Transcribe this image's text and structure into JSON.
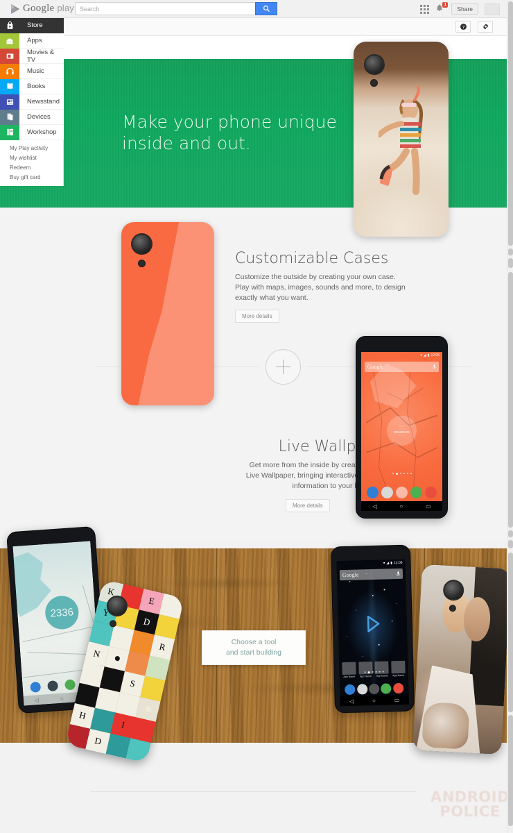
{
  "header": {
    "brand_google": "Google",
    "brand_play": "play",
    "search_placeholder": "Search",
    "search_value": "",
    "search_icon": "magnifier-icon",
    "apps_grid_icon": "apps-grid-icon",
    "bell_icon": "notification-bell-icon",
    "bell_count": "1",
    "share_label": "Share",
    "avatar": "user-avatar",
    "help_icon": "help-icon",
    "settings_icon": "gear-icon"
  },
  "sidebar": {
    "items": [
      {
        "label": "Store",
        "icon": "store-bag-icon",
        "color": "#333333",
        "active": true
      },
      {
        "label": "Apps",
        "icon": "android-apps-icon",
        "color": "#a4c639"
      },
      {
        "label": "Movies & TV",
        "icon": "movies-tv-icon",
        "color": "#d34836"
      },
      {
        "label": "Music",
        "icon": "headphones-music-icon",
        "color": "#f57c00"
      },
      {
        "label": "Books",
        "icon": "open-book-icon",
        "color": "#03a9f4"
      },
      {
        "label": "Newsstand",
        "icon": "newsstand-icon",
        "color": "#3f51b5"
      },
      {
        "label": "Devices",
        "icon": "devices-icon",
        "color": "#607d8b"
      },
      {
        "label": "Workshop",
        "icon": "workshop-icon",
        "color": "#1eb562"
      }
    ],
    "links": [
      "My Play activity",
      "My wishlist",
      "Redeem",
      "Buy gift card"
    ]
  },
  "hero": {
    "title_line1": "Make your phone unique",
    "title_line2": "inside and out.",
    "background_color": "#13a45d",
    "case_image_alt": "girl-at-beach-photo-case"
  },
  "sections": [
    {
      "id": "customizable-cases",
      "title": "Customizable Cases",
      "body_line1": "Customize the outside by creating  your own case.",
      "body_line2": "Play with maps, images, sounds and more, to design",
      "body_line3": "exactly what you want.",
      "button_label": "More details",
      "case_color": "#fa6a42"
    },
    {
      "id": "live-wallpapers",
      "title": "Live Wallpapers",
      "body_line1": "Get more from the inside by creating your own",
      "body_line2": "Live Wallpaper, bringing interactive content and",
      "body_line3": "information to your home screen.",
      "button_label": "More details"
    }
  ],
  "divider": {
    "icon": "plus-circle-icon"
  },
  "cta": {
    "line1": "Choose a tool",
    "line2": "and start building",
    "text_color": "#7fa6a4"
  },
  "devices": {
    "live_wallpaper_phone": {
      "status_time": "12:06",
      "search_text": "Google",
      "wallpaper_label": "DENMARK",
      "mic_icon": "microphone-icon",
      "dock_icons": [
        "phone-icon",
        "camera-icon",
        "app-drawer-icon",
        "hangouts-icon",
        "chrome-icon"
      ],
      "nav_icons": [
        "back-icon",
        "home-icon",
        "recents-icon"
      ]
    },
    "map_phone": {
      "counter": "2336",
      "dock_icons": [
        "phone-icon",
        "camera-icon",
        "hangouts-icon",
        "chrome-icon"
      ],
      "nav_icons": [
        "back-icon",
        "home-icon",
        "recents-icon"
      ]
    },
    "star_phone": {
      "status_time": "12:06",
      "search_text": "Google",
      "app_labels": [
        "App Name",
        "App Name",
        "App Name",
        "App Name"
      ],
      "mic_icon": "microphone-icon",
      "dock_icons": [
        "phone-icon",
        "camera-icon",
        "app-drawer-icon",
        "hangouts-icon",
        "chrome-icon"
      ],
      "nav_icons": [
        "back-icon",
        "home-icon",
        "recents-icon"
      ]
    },
    "checkered_case": {
      "letters": [
        "K",
        "E",
        "",
        "",
        "Y",
        "D",
        "",
        "R",
        "",
        "",
        "",
        "",
        "N",
        "",
        "",
        "",
        "",
        "S",
        "",
        "",
        "",
        "",
        "",
        "",
        "H",
        "",
        "I",
        "",
        "",
        "D",
        "",
        ""
      ]
    },
    "wedding_case": {
      "alt": "wedding-couple-photo-case"
    }
  },
  "watermark": {
    "line1": "ANDROID",
    "line2": "POLICE"
  }
}
